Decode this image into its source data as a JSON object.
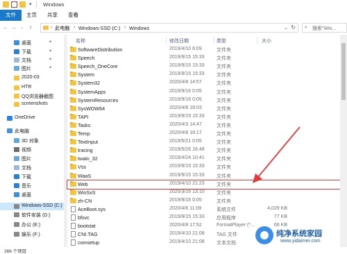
{
  "window": {
    "title": "Windows"
  },
  "ribbon": {
    "tabs": [
      "文件",
      "主页",
      "共享",
      "查看"
    ]
  },
  "address": {
    "crumbs": [
      "此电脑",
      "Windows-SSD (C:)",
      "Windows"
    ]
  },
  "search": {
    "placeholder": "搜索\"Win..."
  },
  "nav": {
    "items": [
      {
        "label": "桌面",
        "pinned": true,
        "icon": "desktop-icon"
      },
      {
        "label": "下载",
        "pinned": true,
        "icon": "download-icon"
      },
      {
        "label": "文档",
        "pinned": true,
        "icon": "document-icon"
      },
      {
        "label": "图片",
        "pinned": true,
        "icon": "picture-icon"
      },
      {
        "label": "2020-03",
        "pinned": false,
        "icon": "folder-icon"
      },
      {
        "label": "HTR",
        "pinned": false,
        "icon": "folder-icon"
      },
      {
        "label": "QQ浏览器截图",
        "pinned": false,
        "icon": "folder-icon"
      },
      {
        "label": "screenshots",
        "pinned": false,
        "icon": "folder-icon"
      },
      {
        "label": "OneDrive",
        "pinned": false,
        "icon": "cloud-icon"
      },
      {
        "label": "此电脑",
        "pinned": false,
        "icon": "computer-icon"
      },
      {
        "label": "3D 对象",
        "pinned": false,
        "icon": "cube-icon"
      },
      {
        "label": "视频",
        "pinned": false,
        "icon": "video-icon"
      },
      {
        "label": "图片",
        "pinned": false,
        "icon": "picture-icon"
      },
      {
        "label": "文档",
        "pinned": false,
        "icon": "document-icon"
      },
      {
        "label": "下载",
        "pinned": false,
        "icon": "download-icon"
      },
      {
        "label": "音乐",
        "pinned": false,
        "icon": "music-icon"
      },
      {
        "label": "桌面",
        "pinned": false,
        "icon": "desktop-icon"
      },
      {
        "label": "Windows-SSD (C:)",
        "pinned": false,
        "icon": "drive-icon",
        "selected": true
      },
      {
        "label": "软件安装 (D:)",
        "pinned": false,
        "icon": "drive-icon"
      },
      {
        "label": "办公 (E:)",
        "pinned": false,
        "icon": "drive-icon"
      },
      {
        "label": "娱乐 (F:)",
        "pinned": false,
        "icon": "drive-icon"
      }
    ]
  },
  "columns": {
    "name": "名称",
    "date": "修改日期",
    "type": "类型",
    "size": "大小"
  },
  "files": [
    {
      "name": "SoftwareDistribution",
      "date": "2019/4/10 6:09",
      "type": "文件夹",
      "size": "",
      "kind": "folder"
    },
    {
      "name": "Speech",
      "date": "2019/9/15 15:33",
      "type": "文件夹",
      "size": "",
      "kind": "folder"
    },
    {
      "name": "Speech_OneCore",
      "date": "2019/9/15 15:33",
      "type": "文件夹",
      "size": "",
      "kind": "folder"
    },
    {
      "name": "System",
      "date": "2019/9/15 15:33",
      "type": "文件夹",
      "size": "",
      "kind": "folder"
    },
    {
      "name": "System32",
      "date": "2020/4/8 14:57",
      "type": "文件夹",
      "size": "",
      "kind": "folder"
    },
    {
      "name": "SystemApps",
      "date": "2019/9/16 0:05",
      "type": "文件夹",
      "size": "",
      "kind": "folder"
    },
    {
      "name": "SystemResources",
      "date": "2019/9/16 0:05",
      "type": "文件夹",
      "size": "",
      "kind": "folder"
    },
    {
      "name": "SysWOW64",
      "date": "2020/4/8 18:03",
      "type": "文件夹",
      "size": "",
      "kind": "folder"
    },
    {
      "name": "TAPI",
      "date": "2019/9/15 15:33",
      "type": "文件夹",
      "size": "",
      "kind": "folder"
    },
    {
      "name": "Tasks",
      "date": "2020/4/3 14:47",
      "type": "文件夹",
      "size": "",
      "kind": "folder"
    },
    {
      "name": "Temp",
      "date": "2020/4/8 18:17",
      "type": "文件夹",
      "size": "",
      "kind": "folder"
    },
    {
      "name": "TextInput",
      "date": "2019/5/21 0:05",
      "type": "文件夹",
      "size": "",
      "kind": "folder"
    },
    {
      "name": "tracing",
      "date": "2019/5/26 16:48",
      "type": "文件夹",
      "size": "",
      "kind": "folder"
    },
    {
      "name": "twain_32",
      "date": "2019/4/24 10:41",
      "type": "文件夹",
      "size": "",
      "kind": "folder"
    },
    {
      "name": "Vss",
      "date": "2019/9/15 15:33",
      "type": "文件夹",
      "size": "",
      "kind": "folder"
    },
    {
      "name": "WaaS",
      "date": "2019/9/15 15:33",
      "type": "文件夹",
      "size": "",
      "kind": "folder"
    },
    {
      "name": "Web",
      "date": "2019/4/10 21:23",
      "type": "文件夹",
      "size": "",
      "kind": "folder",
      "highlight": true
    },
    {
      "name": "WinSxS",
      "date": "2020/3/16 13:10",
      "type": "文件夹",
      "size": "",
      "kind": "folder"
    },
    {
      "name": "zh-CN",
      "date": "2019/9/16 0:05",
      "type": "文件夹",
      "size": "",
      "kind": "folder"
    },
    {
      "name": "AceBoot.sys",
      "date": "2020/4/6 11:09",
      "type": "系统文件",
      "size": "4,029 KB",
      "kind": "file"
    },
    {
      "name": "bfsvc",
      "date": "2019/9/15 15:33",
      "type": "应用程序",
      "size": "77 KB",
      "kind": "file"
    },
    {
      "name": "bootstat",
      "date": "2020/4/8 17:52",
      "type": "FormatPlayer (*...",
      "size": "66 KB",
      "kind": "file"
    },
    {
      "name": "CNI.TAG",
      "date": "2019/4/10 21:08",
      "type": "TAG 文件",
      "size": "",
      "kind": "file"
    },
    {
      "name": "comsetup",
      "date": "2019/4/10 21:08",
      "type": "文本文档",
      "size": "",
      "kind": "file"
    }
  ],
  "status": {
    "count": "266 个项目"
  },
  "watermark": {
    "title": "纯净系统家园",
    "url": "www.yidaimei.com"
  },
  "colors": {
    "accent": "#1979ca",
    "folder": "#f5c342",
    "highlight": "#e23a3a"
  }
}
